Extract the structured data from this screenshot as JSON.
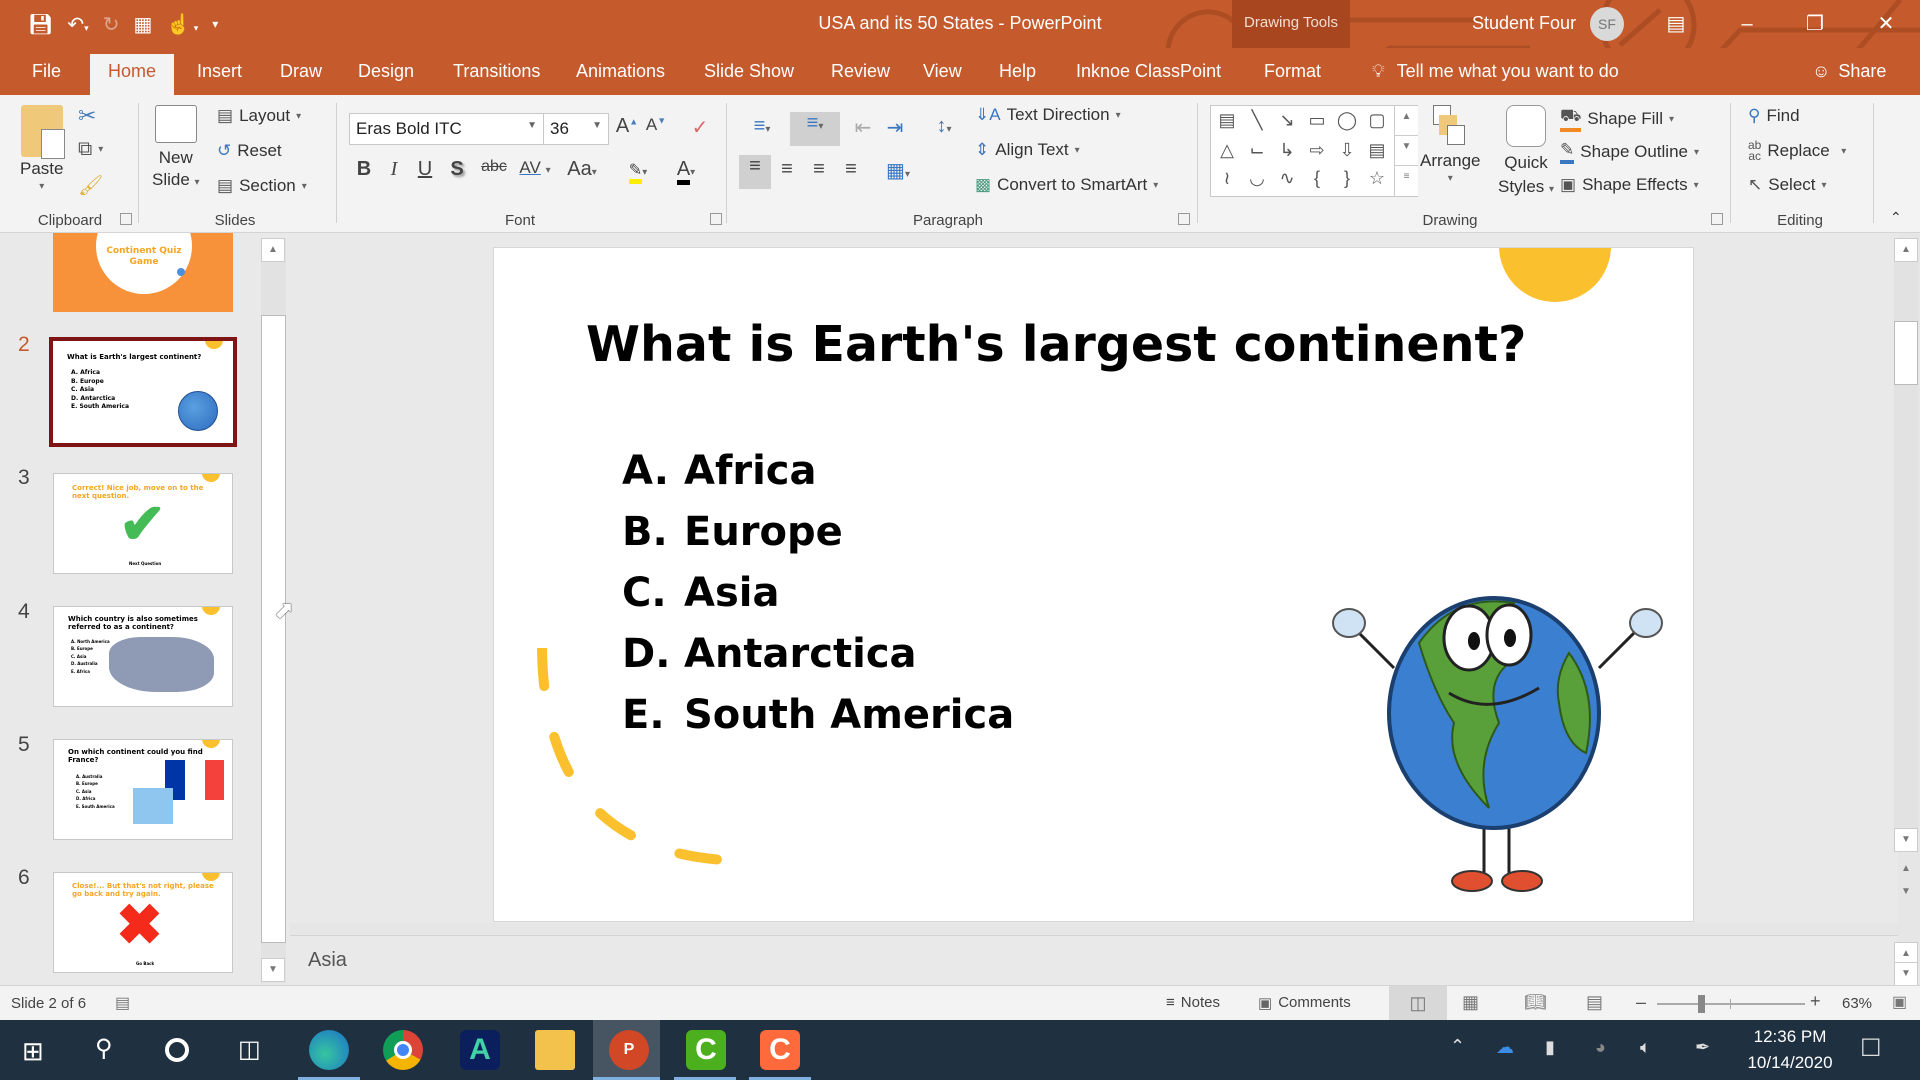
{
  "window": {
    "title": "USA and its 50 States  -  PowerPoint",
    "contextual_group": "Drawing Tools",
    "user_name": "Student Four",
    "user_initials": "SF",
    "accent_color": "#c55a2d"
  },
  "quick_access": {
    "save": "save-icon",
    "undo": "undo-icon",
    "redo": "redo-icon",
    "present": "from-beginning-icon",
    "touch_mode": "touch-mode-icon",
    "customize": "customize-qat-icon"
  },
  "tabs": [
    "File",
    "Home",
    "Insert",
    "Draw",
    "Design",
    "Transitions",
    "Animations",
    "Slide Show",
    "Review",
    "View",
    "Help",
    "Inknoe ClassPoint",
    "Format"
  ],
  "active_tab": "Home",
  "tell_me": "Tell me what you want to do",
  "share": "Share",
  "ribbon": {
    "clipboard": {
      "label": "Clipboard",
      "paste": "Paste"
    },
    "slides": {
      "label": "Slides",
      "new_slide_1": "New",
      "new_slide_2": "Slide",
      "layout": "Layout",
      "reset": "Reset",
      "section": "Section"
    },
    "font": {
      "label": "Font",
      "font_name": "Eras Bold ITC",
      "font_size": "36",
      "bold": "B",
      "italic": "I",
      "underline": "U",
      "shadow": "S",
      "strike": "abc",
      "spacing": "AV",
      "case": "Aa",
      "color_letter": "A"
    },
    "paragraph": {
      "label": "Paragraph",
      "text_direction": "Text Direction",
      "align_text": "Align Text",
      "smartart": "Convert to SmartArt"
    },
    "drawing": {
      "label": "Drawing",
      "arrange": "Arrange",
      "quick_styles_1": "Quick",
      "quick_styles_2": "Styles",
      "shape_fill": "Shape Fill",
      "shape_outline": "Shape Outline",
      "shape_effects": "Shape Effects"
    },
    "editing": {
      "label": "Editing",
      "find": "Find",
      "replace": "Replace",
      "select": "Select"
    }
  },
  "thumbnails": [
    {
      "num": "1",
      "title": "Continent Quiz Game"
    },
    {
      "num": "2",
      "title": "What is Earth's largest continent?",
      "answers": [
        "A. Africa",
        "B. Europe",
        "C. Asia",
        "D. Antarctica",
        "E. South America"
      ],
      "active": true
    },
    {
      "num": "3",
      "title": "Correct! Nice job, move on to the next question.",
      "button": "Next Question"
    },
    {
      "num": "4",
      "title": "Which country is also sometimes referred to as a continent?",
      "answers": [
        "A. North America",
        "B. Europe",
        "C. Asia",
        "D. Australia",
        "E. Africa"
      ]
    },
    {
      "num": "5",
      "title": "On which continent could you find France?",
      "answers": [
        "A. Australia",
        "B. Europe",
        "C. Asia",
        "D. Africa",
        "E. South America"
      ]
    },
    {
      "num": "6",
      "title": "Close!... But that's not right, please go back and try again.",
      "button": "Go Back"
    }
  ],
  "slide": {
    "title": "What is Earth's largest continent?",
    "answers": [
      {
        "letter": "A.",
        "text": "Africa"
      },
      {
        "letter": "B.",
        "text": "Europe"
      },
      {
        "letter": "C.",
        "text": "Asia"
      },
      {
        "letter": "D.",
        "text": "Antarctica"
      },
      {
        "letter": "E.",
        "text": "South America"
      }
    ],
    "image": "cartoon-earth-character"
  },
  "notes_text": "Asia",
  "status": {
    "slide_indicator": "Slide 2 of 6",
    "notes": "Notes",
    "comments": "Comments",
    "zoom_percent": "63%",
    "zoom_level": 0.63
  },
  "taskbar": {
    "apps": [
      "Start",
      "Search",
      "Cortana",
      "Task View",
      "Microsoft Edge",
      "Google Chrome",
      "ActivInspire",
      "File Explorer",
      "PowerPoint",
      "Camtasia",
      "Camtasia Recorder"
    ],
    "time": "12:36 PM",
    "date": "10/14/2020"
  }
}
